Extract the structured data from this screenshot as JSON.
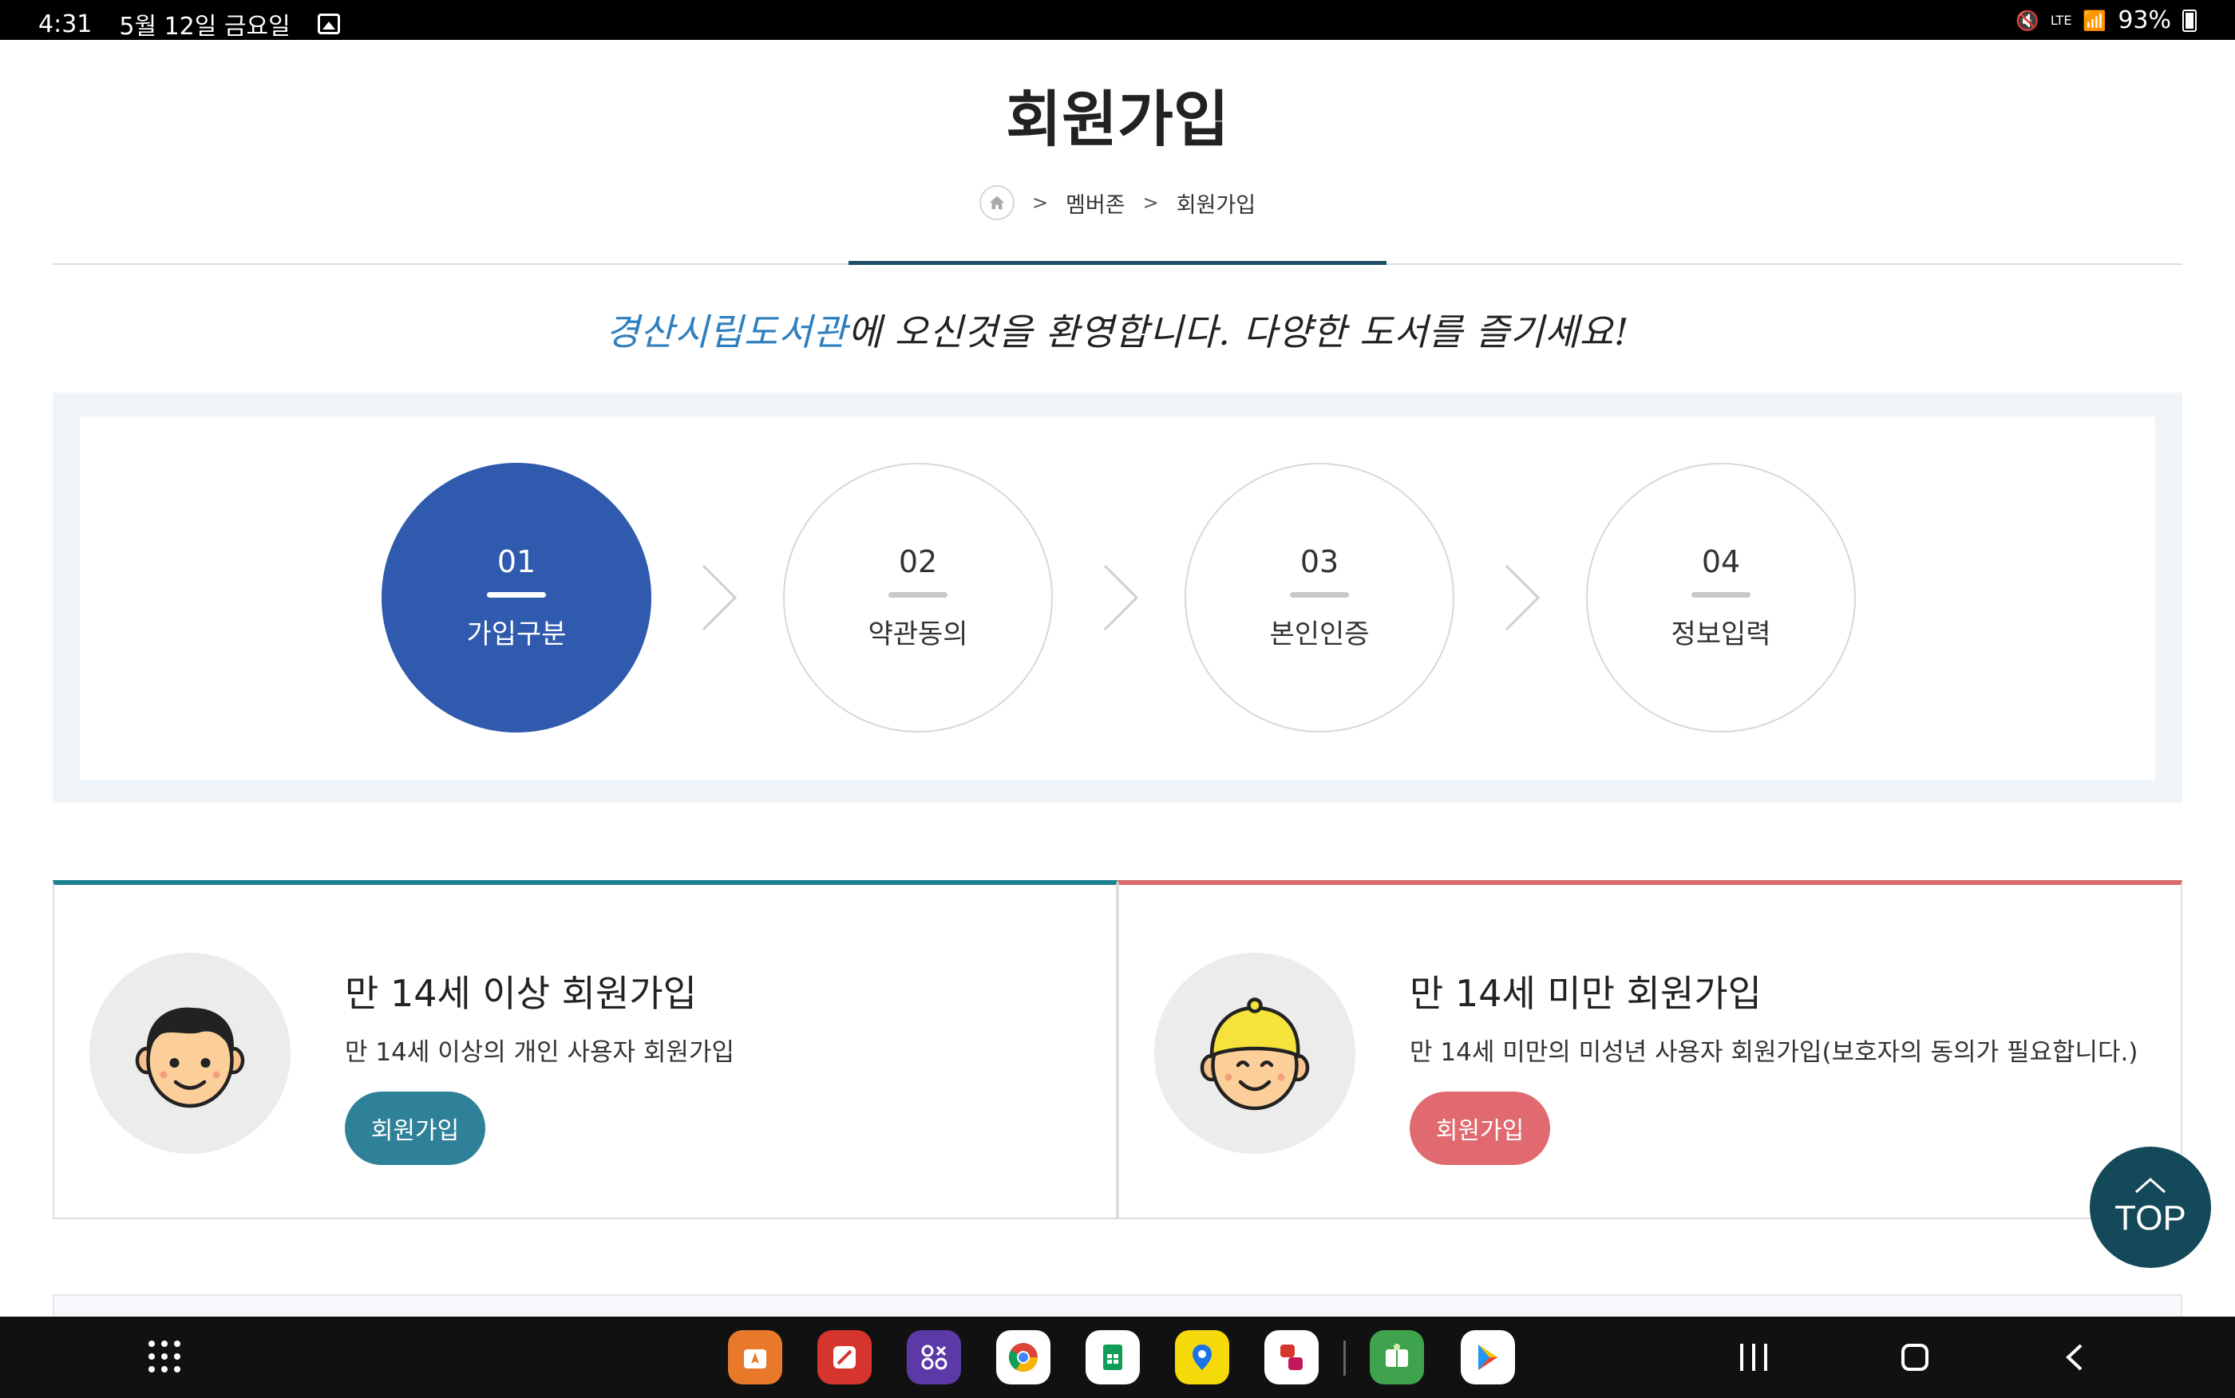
{
  "status_bar": {
    "time": "4:31",
    "date": "5월 12일 금요일",
    "network": "LTE",
    "battery": "93%"
  },
  "header": {
    "title": "회원가입",
    "breadcrumb": [
      "멤버존",
      "회원가입"
    ],
    "breadcrumb_sep": ">"
  },
  "welcome": {
    "highlight": "경산시립도서관",
    "rest": "에 오신것을 환영합니다. 다양한 도서를 즐기세요!"
  },
  "steps": [
    {
      "num": "01",
      "label": "가입구분",
      "active": true
    },
    {
      "num": "02",
      "label": "약관동의",
      "active": false
    },
    {
      "num": "03",
      "label": "본인인증",
      "active": false
    },
    {
      "num": "04",
      "label": "정보입력",
      "active": false
    }
  ],
  "cards": {
    "adult": {
      "title": "만 14세 이상 회원가입",
      "desc": "만 14세 이상의 개인 사용자 회원가입",
      "button": "회원가입",
      "accent": "#1c8291"
    },
    "child": {
      "title": "만 14세 미만 회원가입",
      "desc": "만 14세 미만의 미성년 사용자 회원가입(보호자의 동의가 필요합니다.)",
      "button": "회원가입",
      "accent": "#d96a6a"
    }
  },
  "top_button": "TOP",
  "colors": {
    "primary": "#2f5aad",
    "dark_teal": "#14495a"
  }
}
